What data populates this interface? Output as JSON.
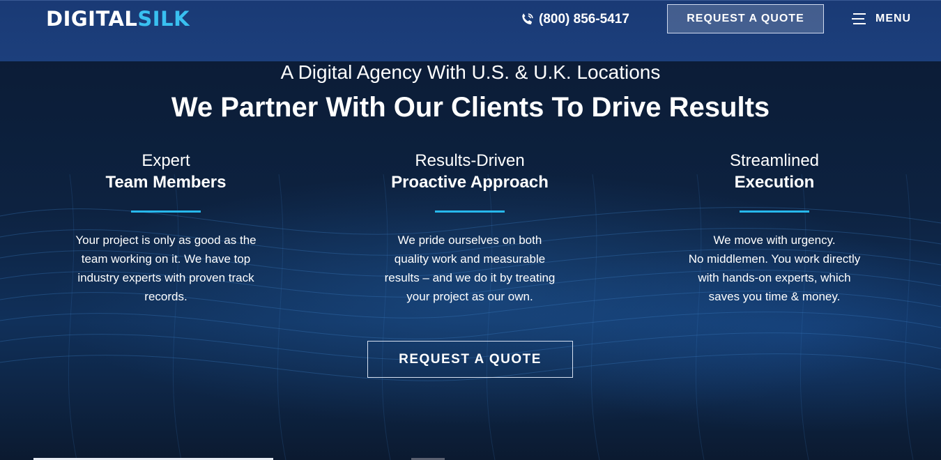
{
  "header": {
    "logo_part1": "DIGITAL",
    "logo_part2": "SILK",
    "phone": "(800) 856-5417",
    "quote_button": "REQUEST A QUOTE",
    "menu_label": "MENU"
  },
  "hero": {
    "subtitle": "A Digital Agency With U.S. & U.K. Locations",
    "title": "We Partner With Our Clients To Drive Results"
  },
  "features": [
    {
      "line1": "Expert",
      "line2": "Team Members",
      "desc": [
        "Your project is only as good as the",
        "team working on it. We have top",
        "industry experts with proven track",
        "records."
      ]
    },
    {
      "line1": "Results-Driven",
      "line2": "Proactive Approach",
      "desc": [
        "We pride ourselves on both",
        "quality work and measurable",
        "results – and we do it by treating",
        "your project as our own."
      ]
    },
    {
      "line1": "Streamlined",
      "line2": "Execution",
      "desc": [
        "We move with urgency.",
        "No middlemen. You work directly",
        "with hands-on experts, which",
        "saves you time & money."
      ]
    }
  ],
  "cta": {
    "label": "REQUEST A QUOTE"
  },
  "colors": {
    "accent": "#27b8ec",
    "header_bg": "#1c3f7c",
    "hero_bg": "#0d2240"
  },
  "icons": {
    "phone": "phone-icon",
    "menu": "hamburger-menu-icon"
  }
}
